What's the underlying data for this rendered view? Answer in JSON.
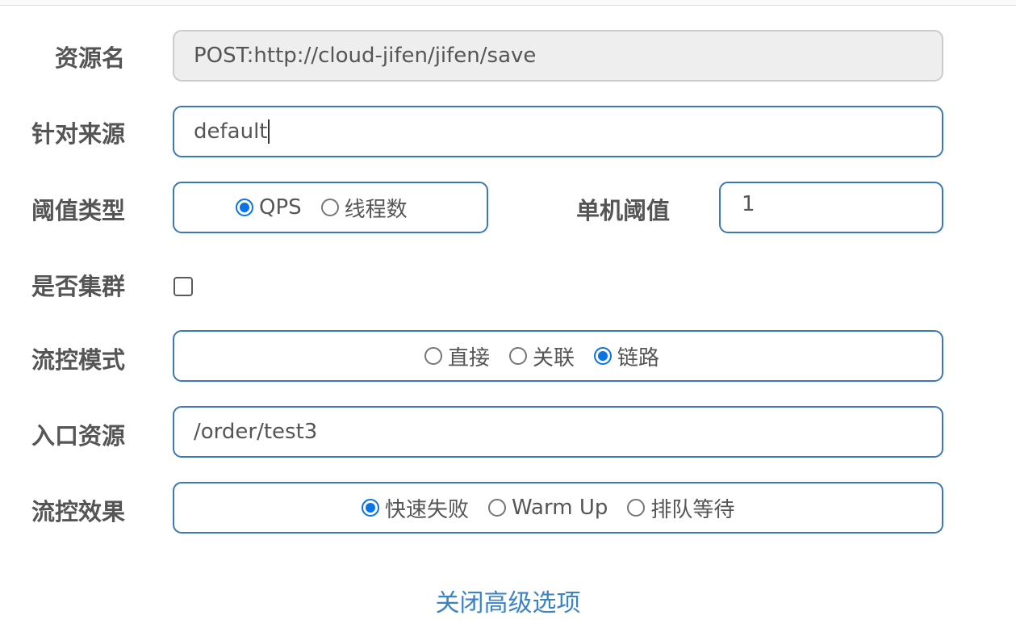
{
  "form": {
    "resource_name": {
      "label": "资源名",
      "value": "POST:http://cloud-jifen/jifen/save"
    },
    "limit_app": {
      "label": "针对来源",
      "value": "default"
    },
    "grade": {
      "label": "阈值类型",
      "options": [
        {
          "label": "QPS",
          "checked": true
        },
        {
          "label": "线程数",
          "checked": false
        }
      ]
    },
    "count": {
      "label": "单机阈值",
      "value": "1"
    },
    "cluster": {
      "label": "是否集群",
      "checked": false
    },
    "strategy": {
      "label": "流控模式",
      "options": [
        {
          "label": "直接",
          "checked": false
        },
        {
          "label": "关联",
          "checked": false
        },
        {
          "label": "链路",
          "checked": true
        }
      ]
    },
    "ref_resource": {
      "label": "入口资源",
      "value": "/order/test3"
    },
    "control_behavior": {
      "label": "流控效果",
      "options": [
        {
          "label": "快速失败",
          "checked": true
        },
        {
          "label": "Warm Up",
          "checked": false
        },
        {
          "label": "排队等待",
          "checked": false
        }
      ]
    },
    "advanced_toggle": "关闭高级选项"
  },
  "colors": {
    "border": "#3c78b4",
    "radio_checked": "#0a73e6",
    "link": "#3c83c6"
  }
}
